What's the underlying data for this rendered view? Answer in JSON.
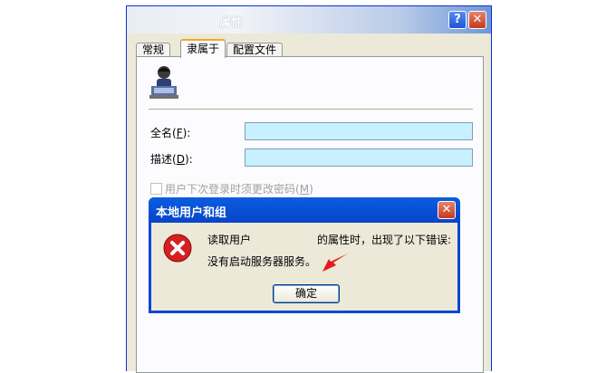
{
  "window": {
    "title": "属性",
    "help_label": "?",
    "close_label": "✕"
  },
  "tabs": [
    {
      "label": "常规"
    },
    {
      "label": "隶属于"
    },
    {
      "label": "配置文件"
    }
  ],
  "form": {
    "fullname_label": "全名",
    "fullname_key": "F",
    "fullname_suffix": ":",
    "fullname_value": "",
    "desc_label": "描述",
    "desc_key": "D",
    "desc_suffix": ":",
    "desc_value": "",
    "checkbox_label": "用户下次登录时须更改密码",
    "checkbox_key": "M"
  },
  "dialog": {
    "title": "本地用户和组",
    "close_label": "✕",
    "line1_part1": "读取用户",
    "line1_part2": "的属性时，出现了以下错误:",
    "line2": "没有启动服务器服务。",
    "ok_label": "确定"
  },
  "colors": {
    "field_bg": "#c8f0ff",
    "dialog_frame": "#0a47d4",
    "error_red": "#d42020",
    "arrow_red": "#e21b1b"
  }
}
